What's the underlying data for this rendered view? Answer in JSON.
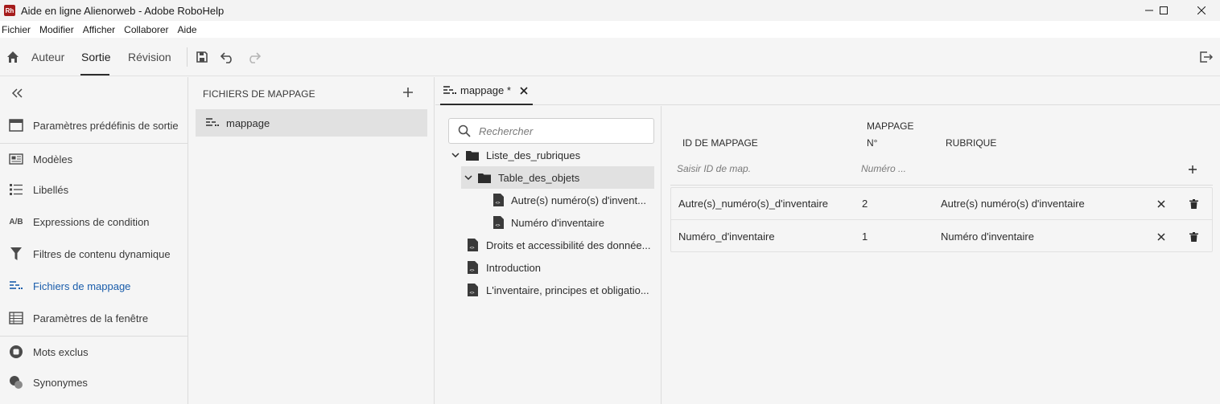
{
  "window": {
    "title": "Aide en ligne Alienorweb - Adobe RoboHelp",
    "app_logo_text": "Rh",
    "controls": [
      "minimize",
      "maximize",
      "close"
    ]
  },
  "menu": [
    "Fichier",
    "Modifier",
    "Afficher",
    "Collaborer",
    "Aide"
  ],
  "toolbar": {
    "tabs": [
      "Auteur",
      "Sortie",
      "Révision"
    ],
    "active_tab": "Sortie"
  },
  "leftnav": {
    "items": [
      {
        "label": "Paramètres prédéfinis de sortie",
        "icon": "preset-icon"
      },
      {
        "label": "Modèles",
        "icon": "template-icon"
      },
      {
        "label": "Libellés",
        "icon": "labels-icon"
      },
      {
        "label": "Expressions de condition",
        "icon": "ab-icon",
        "icon_text": "A/B"
      },
      {
        "label": "Filtres de contenu dynamique",
        "icon": "filter-icon"
      },
      {
        "label": "Fichiers de mappage",
        "icon": "map-file-icon",
        "active": true
      },
      {
        "label": "Paramètres de la fenêtre",
        "icon": "window-settings-icon"
      },
      {
        "label": "Mots exclus",
        "icon": "stop-words-icon"
      },
      {
        "label": "Synonymes",
        "icon": "synonyms-icon"
      }
    ]
  },
  "filepanel": {
    "title": "FICHIERS DE MAPPAGE",
    "items": [
      {
        "label": "mappage"
      }
    ]
  },
  "editor": {
    "tab_label": "mappage *",
    "search_placeholder": "Rechercher",
    "tree": [
      {
        "label": "Liste_des_rubriques",
        "type": "folder",
        "expanded": true,
        "level": 0
      },
      {
        "label": "Table_des_objets",
        "type": "folder",
        "expanded": true,
        "level": 1,
        "selected": true
      },
      {
        "label": "Autre(s) numéro(s) d'invent...",
        "type": "topic",
        "level": 2
      },
      {
        "label": "Numéro d'inventaire",
        "type": "topic",
        "level": 2
      },
      {
        "label": "Droits et accessibilité des donnée...",
        "type": "topic",
        "level": 0
      },
      {
        "label": "Introduction",
        "type": "topic",
        "level": 0
      },
      {
        "label": "L'inventaire, principes et obligatio...",
        "type": "topic",
        "level": 0
      }
    ],
    "map": {
      "headers": {
        "id": "ID DE MAPPAGE",
        "num_line1": "MAPPAGE",
        "num_line2": "N°",
        "topic": "RUBRIQUE"
      },
      "id_placeholder": "Saisir ID de map.",
      "num_placeholder": "Numéro ...",
      "rows": [
        {
          "id": "Autre(s)_numéro(s)_d'inventaire",
          "num": "2",
          "topic": "Autre(s) numéro(s) d'inventaire"
        },
        {
          "id": "Numéro_d'inventaire",
          "num": "1",
          "topic": "Numéro d'inventaire"
        }
      ]
    }
  }
}
